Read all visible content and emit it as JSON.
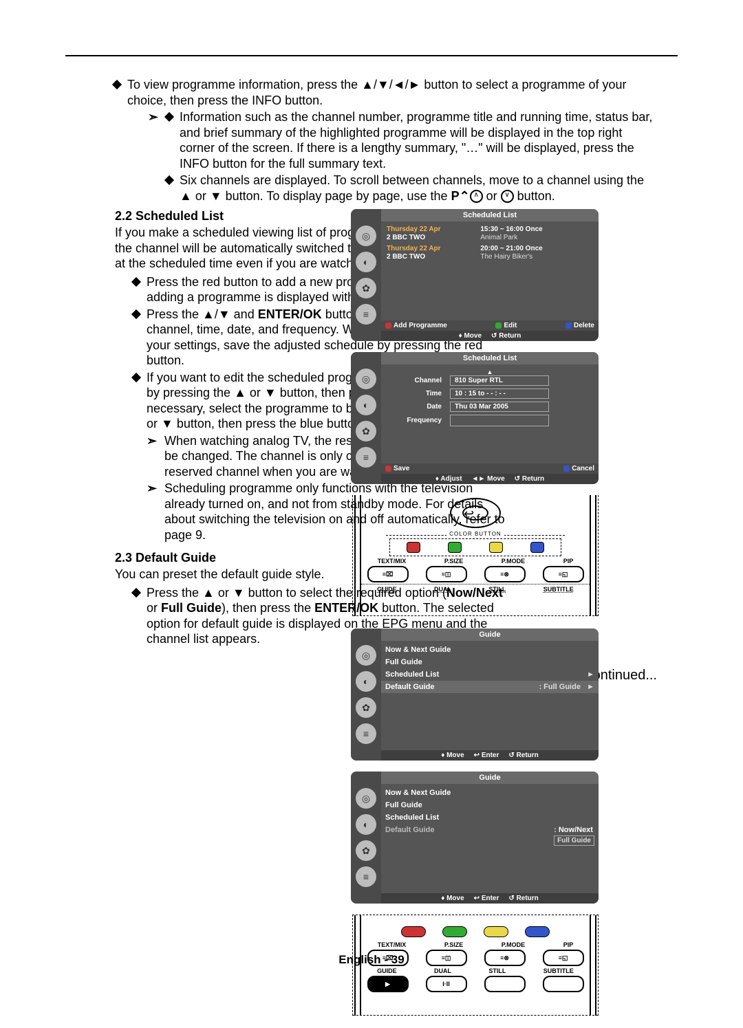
{
  "intro": {
    "p1": "To view programme information, press the ▲/▼/◄/► button to select a programme of your choice, then press the INFO button.",
    "sub1": "Information such as the channel number, programme title and running time, status bar, and brief summary of the highlighted programme will be displayed in the top right corner of the screen. If there is a lengthy summary, \"…\" will be displayed, press the INFO button for the full summary text.",
    "sub2_pre": "Six channels are displayed. To scroll between channels, move to a channel using the ▲ or ▼ button. To display page by page, use the ",
    "sub2_mid": " or ",
    "sub2_post": " button.",
    "p_up_label": "P⌃",
    "p_down_label": "⌄"
  },
  "s22": {
    "heading": "2.2  Scheduled List",
    "para": "If you make a scheduled viewing list of programmes you may like to see, the channel will be automatically switched to the scheduled programme at the scheduled time even if you are watching another programme.",
    "b1": "Press the red button to add a new programme. The menu for adding a programme is displayed with Channel selected.",
    "b2": "Press the ▲/▼ and ENTER/OK buttons to set the required channel, time, date, and frequency. When you are satisfied with your settings, save the adjusted schedule by pressing the red button.",
    "b3": "If you want to edit the scheduled programme, select a programme by pressing the ▲ or ▼ button, then press the green button. If necessary, select the programme to be deleted by pressing the ▲ or ▼ button, then press the blue button.",
    "b3_n1": "When watching analog TV, the reserved DTV channel cannot be changed. The channel is only changed automatically to the reserved channel when you are watching DTV.",
    "b3_n2": "Scheduling programme only functions with the television already turned on, and not from standby mode. For details about switching the television on and off automatically, refer to page 9."
  },
  "s23": {
    "heading": "2.3  Default Guide",
    "para": "You can preset the default guide style.",
    "b1": "Press the ▲ or ▼ button to select the required option (Now/Next or Full Guide), then press the ENTER/OK button. The selected option for default guide is displayed on the EPG menu and the channel list appears."
  },
  "continued": "Continued...",
  "footer": "English - 39",
  "panel_sched_list": {
    "title": "Scheduled List",
    "rows": [
      {
        "day": "Thursday 22 Apr",
        "ch": "2 BBC TWO",
        "time": "15:30 ~ 16:00 Once",
        "prog": "Animal Park"
      },
      {
        "day": "Thursday 22 Apr",
        "ch": "2 BBC TWO",
        "time": "20:00 ~ 21:00 Once",
        "prog": "The Hairy Biker's"
      }
    ],
    "bottom": {
      "add": "Add Programme",
      "edit": "Edit",
      "delete": "Delete",
      "move": "Move",
      "ret": "Return"
    }
  },
  "panel_sched_edit": {
    "title": "Scheduled List",
    "arrow": "▲",
    "fields": {
      "channel_lbl": "Channel",
      "channel_val": "810 Super RTL",
      "time_lbl": "Time",
      "time_val": "10 : 15 to - - : - -",
      "date_lbl": "Date",
      "date_val": "Thu 03 Mar 2005",
      "freq_lbl": "Frequency",
      "freq_val": ""
    },
    "bottom": {
      "save": "Save",
      "cancel": "Cancel",
      "adjust": "Adjust",
      "move": "Move",
      "ret": "Return"
    }
  },
  "panel_guide1": {
    "title": "Guide",
    "items": {
      "nn": "Now & Next Guide",
      "full": "Full Guide",
      "sched": "Scheduled List",
      "def_lbl": "Default Guide",
      "def_val": ": Full Guide"
    },
    "bottom": {
      "move": "Move",
      "enter": "Enter",
      "ret": "Return"
    }
  },
  "panel_guide2": {
    "title": "Guide",
    "items": {
      "nn": "Now & Next Guide",
      "full": "Full Guide",
      "sched": "Scheduled List",
      "def_lbl": "Default Guide",
      "opt1": "Now/Next",
      "opt2": "Full Guide"
    },
    "bottom": {
      "move": "Move",
      "enter": "Enter",
      "ret": "Return"
    }
  },
  "remote": {
    "color_label": "COLOR BUTTON",
    "row1": [
      "TEXT/MIX",
      "P.SIZE",
      "P.MODE",
      "PIP"
    ],
    "row2": [
      "GUIDE",
      "DUAL",
      "STILL",
      "SUBTITLE"
    ],
    "dual": "I·II"
  }
}
